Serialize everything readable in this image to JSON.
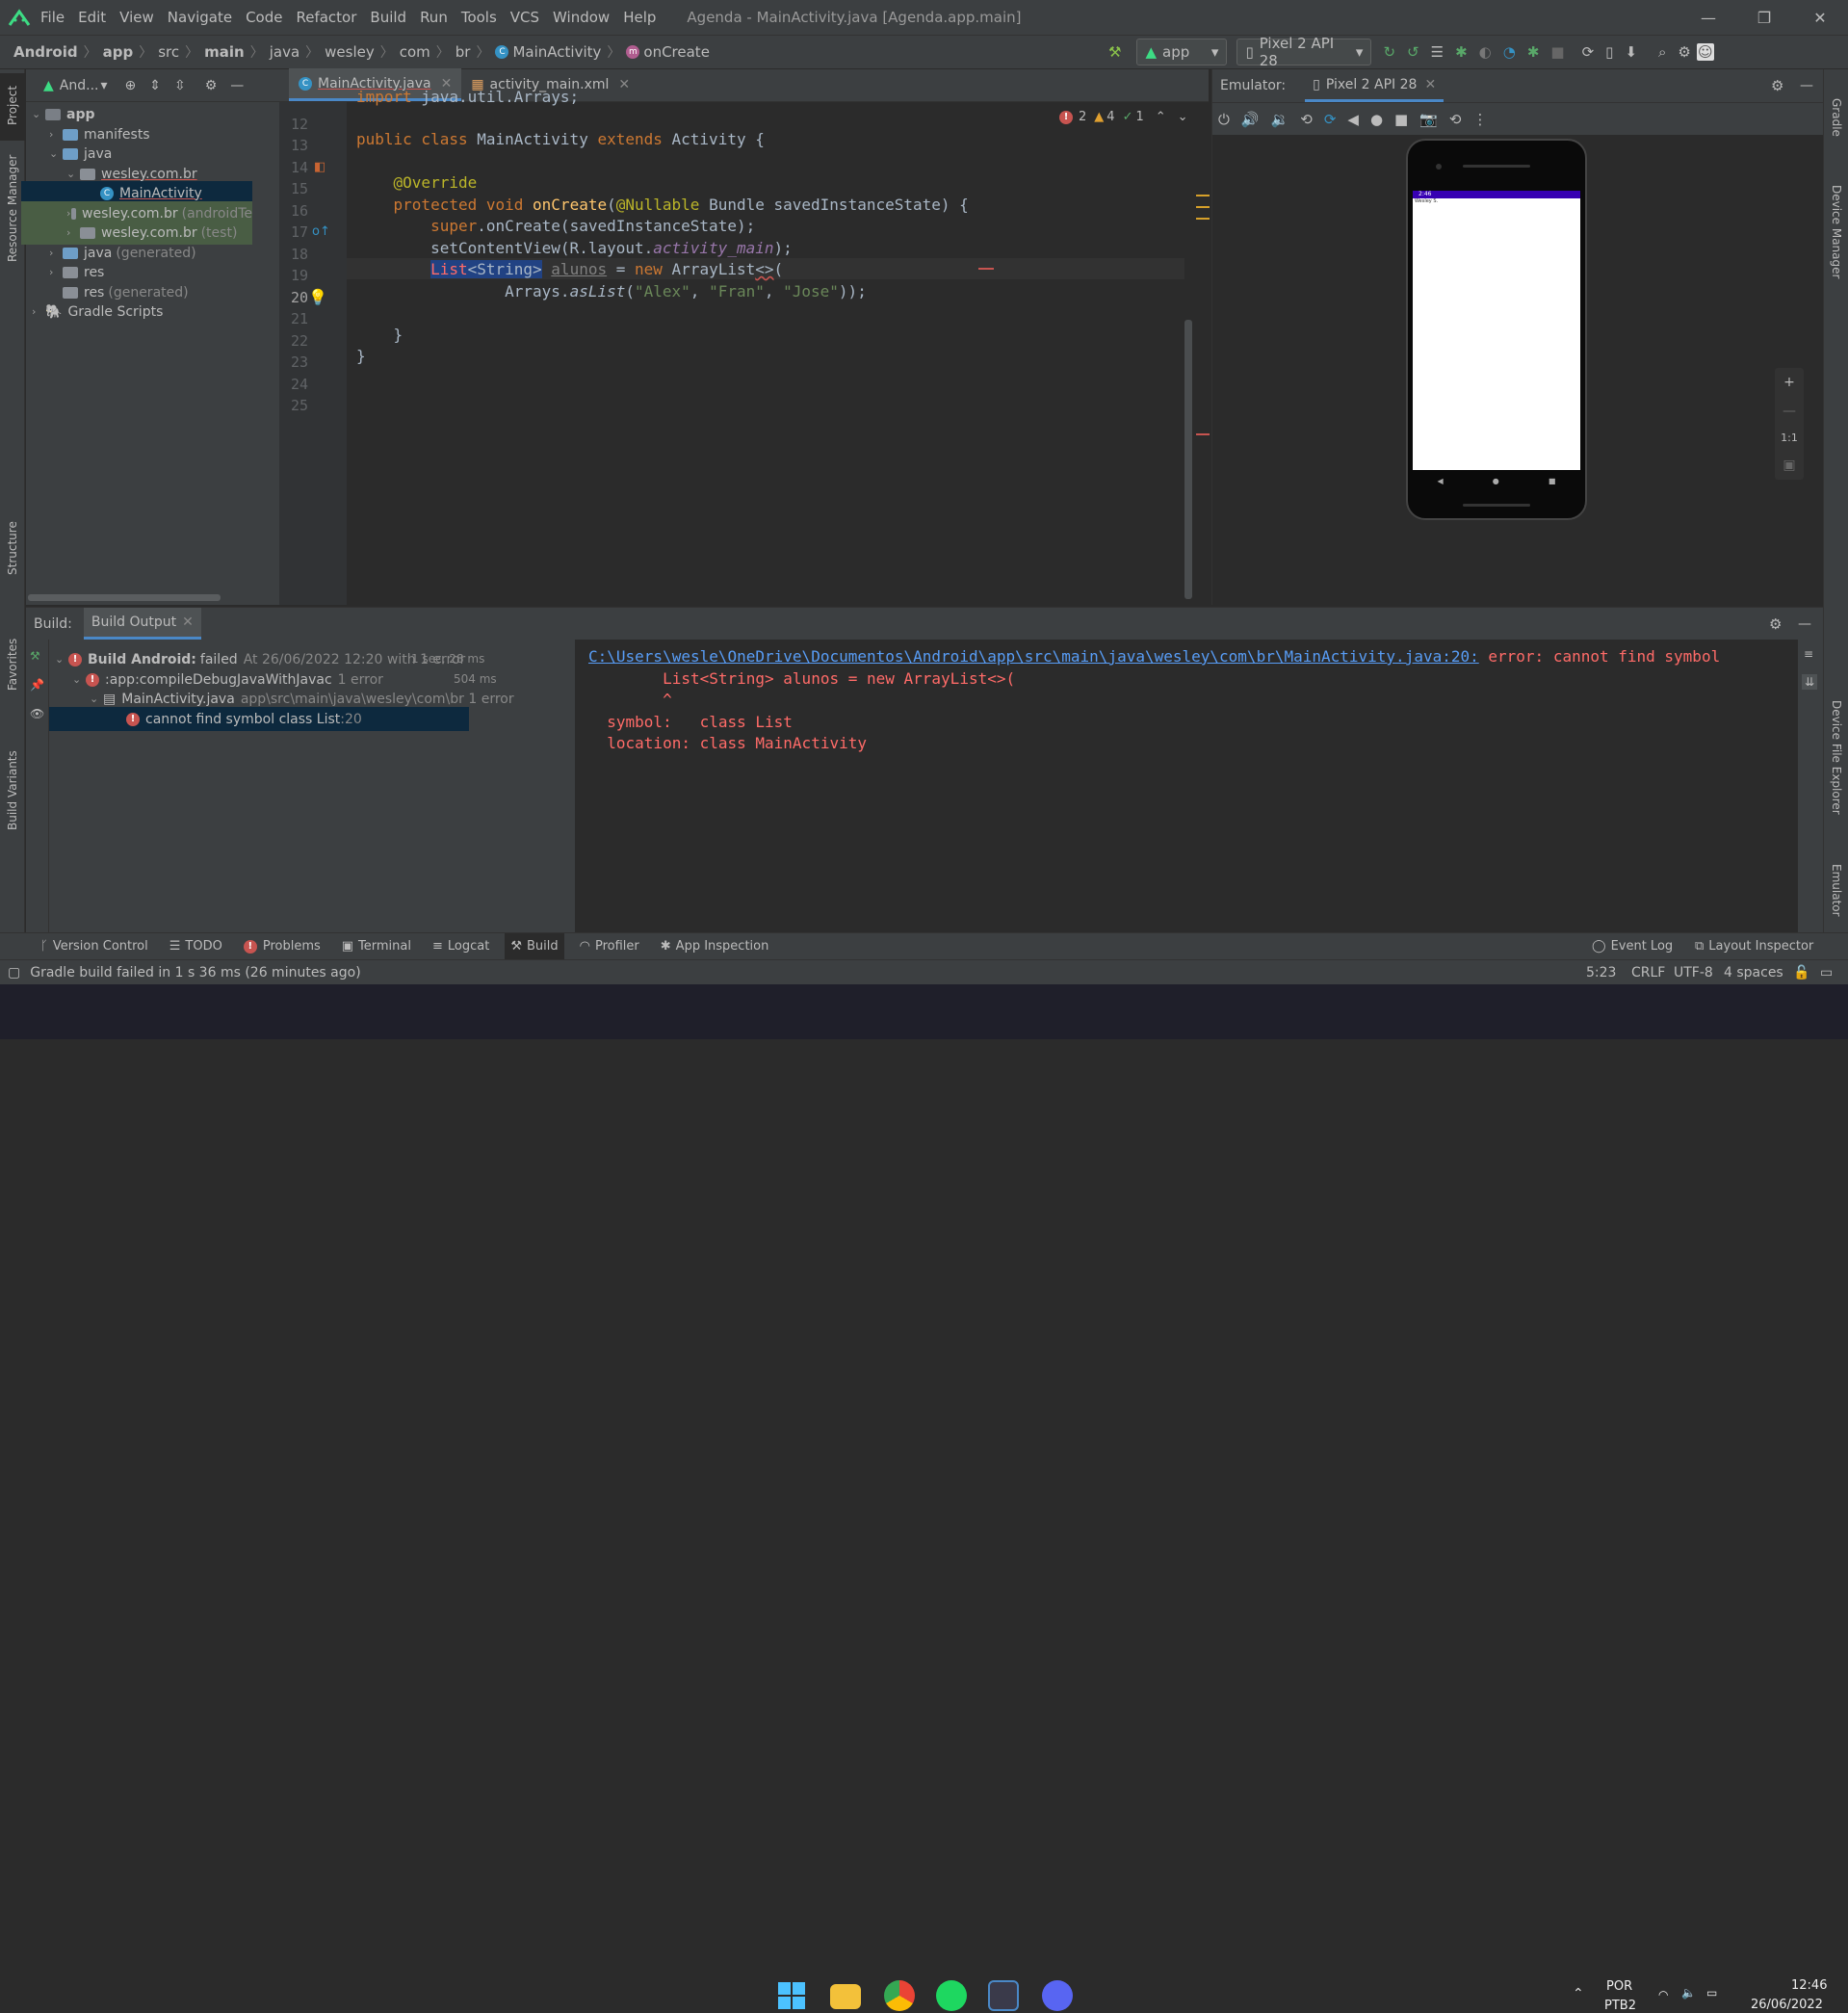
{
  "window": {
    "menu": [
      "File",
      "Edit",
      "View",
      "Navigate",
      "Code",
      "Refactor",
      "Build",
      "Run",
      "Tools",
      "VCS",
      "Window",
      "Help"
    ],
    "title": "Agenda - MainActivity.java [Agenda.app.main]"
  },
  "breadcrumb": [
    "Android",
    "app",
    "src",
    "main",
    "java",
    "wesley",
    "com",
    "br",
    "MainActivity",
    "onCreate"
  ],
  "toolbar": {
    "run_config": "app",
    "device": "Pixel 2 API 28"
  },
  "left_strip": [
    "Project",
    "Resource Manager",
    "Structure",
    "Favorites",
    "Build Variants"
  ],
  "right_strip": [
    "Gradle",
    "Device Manager",
    "Device File Explorer",
    "Emulator"
  ],
  "project": {
    "view_label": "And...",
    "tree": [
      {
        "label": "app",
        "bold": true
      },
      {
        "label": "manifests"
      },
      {
        "label": "java"
      },
      {
        "label": "wesley.com.br"
      },
      {
        "label": "MainActivity"
      },
      {
        "label": "wesley.com.br",
        "hint": "(androidTe"
      },
      {
        "label": "wesley.com.br",
        "hint": "(test)"
      },
      {
        "label": "java",
        "hint": "(generated)"
      },
      {
        "label": "res"
      },
      {
        "label": "res",
        "hint": "(generated)"
      },
      {
        "label": "Gradle Scripts"
      }
    ]
  },
  "editor": {
    "tabs": [
      "MainActivity.java",
      "activity_main.xml"
    ],
    "inspections": {
      "errors": "2",
      "warnings": "4",
      "ok": "1"
    },
    "line_numbers": [
      "12",
      "13",
      "14",
      "15",
      "16",
      "17",
      "18",
      "19",
      "20",
      "21",
      "22",
      "23",
      "24",
      "25"
    ],
    "lines": [
      "import java.util.Arrays;",
      "",
      "public class MainActivity extends Activity {",
      "",
      "    @Override",
      "    protected void onCreate(@Nullable Bundle savedInstanceState) {",
      "        super.onCreate(savedInstanceState);",
      "        setContentView(R.layout.activity_main);",
      "        List<String> alunos = new ArrayList<>(",
      "                Arrays.asList(\"Alex\", \"Fran\", \"Jose\"));",
      "",
      "    }",
      "}",
      ""
    ]
  },
  "emulator": {
    "label": "Emulator:",
    "device_tab": "Pixel 2 API 28",
    "status_time": "2:46",
    "app_text": "Wesley S.",
    "zoom_ratio": "1:1"
  },
  "build": {
    "label": "Build:",
    "tab": "Build Output",
    "tree": [
      {
        "title": "Build Android:",
        "status": "failed",
        "detail": "At 26/06/2022 12:20 with 1 error",
        "time": "1 sec, 28 ms"
      },
      {
        "title": ":app:compileDebugJavaWithJavac",
        "detail": "1 error",
        "time": "504 ms"
      },
      {
        "title": "MainActivity.java",
        "detail": "app\\src\\main\\java\\wesley\\com\\br 1 error"
      },
      {
        "title": "cannot find symbol class List",
        "detail": ":20"
      }
    ],
    "output": {
      "path": "C:\\Users\\wesle\\OneDrive\\Documentos\\Android\\app\\src\\main\\java\\wesley\\com\\br\\MainActivity.java:20:",
      "error": " error: cannot find symbol",
      "code": "        List<String> alunos = new ArrayList<>(",
      "caret": "        ^",
      "symbol": "  symbol:   class List",
      "location": "  location: class MainActivity"
    }
  },
  "tool_windows": [
    "Version Control",
    "TODO",
    "Problems",
    "Terminal",
    "Logcat",
    "Build",
    "Profiler",
    "App Inspection"
  ],
  "tool_windows_right": [
    "Event Log",
    "Layout Inspector"
  ],
  "status": {
    "message": "Gradle build failed in 1 s 36 ms (26 minutes ago)",
    "position": "5:23",
    "line_sep": "CRLF",
    "encoding": "UTF-8",
    "indent": "4 spaces"
  },
  "taskbar": {
    "lang1": "POR",
    "lang2": "PTB2",
    "time": "12:46",
    "date": "26/06/2022"
  }
}
